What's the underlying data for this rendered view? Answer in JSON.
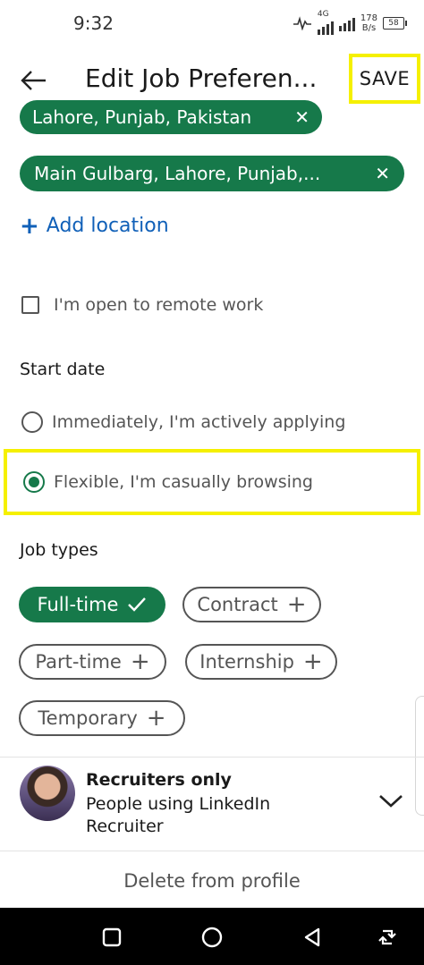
{
  "status_bar": {
    "time": "9:32",
    "network": "4G",
    "speed_value": "178",
    "speed_unit": "B/s",
    "battery": "58"
  },
  "header": {
    "back_icon": "arrow-left-icon",
    "title": "Edit Job Preferen...",
    "save_label": "SAVE"
  },
  "locations": [
    {
      "label": "Lahore, Punjab, Pakistan",
      "remove_icon": "close-icon"
    },
    {
      "label": "Main Gulbarg, Lahore, Punjab,...",
      "remove_icon": "close-icon"
    }
  ],
  "add_location": {
    "icon": "plus-icon",
    "label": "Add location"
  },
  "remote": {
    "label": "I'm open to remote work",
    "checked": false
  },
  "start_date": {
    "title": "Start date",
    "options": [
      {
        "label": "Immediately, I'm actively applying",
        "selected": false
      },
      {
        "label": "Flexible, I'm casually browsing",
        "selected": true
      }
    ]
  },
  "job_types": {
    "title": "Job types",
    "options": [
      {
        "label": "Full-time",
        "selected": true,
        "icon": "check-icon"
      },
      {
        "label": "Contract",
        "selected": false,
        "icon": "plus-icon"
      },
      {
        "label": "Part-time",
        "selected": false,
        "icon": "plus-icon"
      },
      {
        "label": "Internship",
        "selected": false,
        "icon": "plus-icon"
      },
      {
        "label": "Temporary",
        "selected": false,
        "icon": "plus-icon"
      }
    ]
  },
  "visibility": {
    "title": "Recruiters only",
    "description": "People using LinkedIn Recruiter",
    "icon": "chevron-down-icon"
  },
  "delete_label": "Delete from profile",
  "colors": {
    "accent_green": "#16794a",
    "link_blue": "#1060b8",
    "highlight_yellow": "#f5f000"
  },
  "nav_bar": {
    "icons": [
      "square-icon",
      "circle-icon",
      "triangle-back-icon",
      "rotate-icon"
    ]
  }
}
